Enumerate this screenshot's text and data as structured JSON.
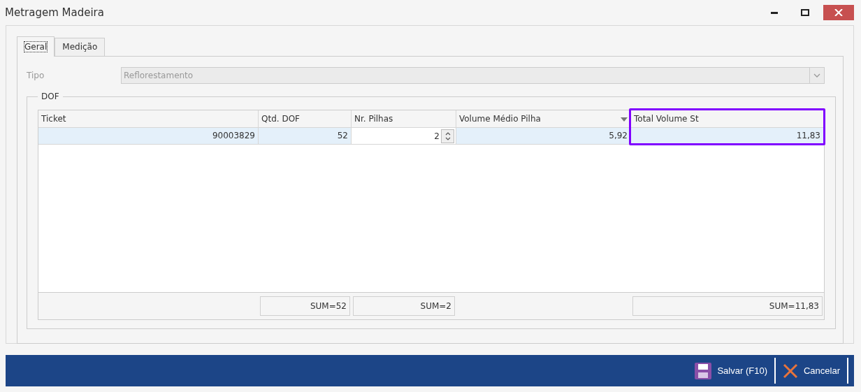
{
  "window": {
    "title": "Metragem Madeira"
  },
  "tabs": [
    {
      "label": "Geral",
      "selected": true
    },
    {
      "label": "Medição",
      "selected": false
    }
  ],
  "tipo": {
    "label": "Tipo",
    "value": "Reflorestamento",
    "disabled": true
  },
  "group": {
    "title": "DOF"
  },
  "grid": {
    "columns": [
      {
        "label": "Ticket",
        "sorted": false,
        "highlighted": false
      },
      {
        "label": "Qtd. DOF",
        "sorted": false,
        "highlighted": false
      },
      {
        "label": "Nr. Pilhas",
        "sorted": false,
        "highlighted": false
      },
      {
        "label": "Volume Médio Pilha",
        "sorted": true,
        "highlighted": false
      },
      {
        "label": "Total Volume St",
        "sorted": false,
        "highlighted": true
      }
    ],
    "rows": [
      {
        "selected": true,
        "cells": [
          {
            "kind": "text",
            "value": "90003829"
          },
          {
            "kind": "text",
            "value": "52"
          },
          {
            "kind": "spin",
            "value": "2"
          },
          {
            "kind": "text",
            "value": "5,92"
          },
          {
            "kind": "text",
            "value": "11,83"
          }
        ]
      }
    ],
    "footer": [
      {
        "kind": "blank"
      },
      {
        "kind": "sum",
        "value": "SUM=52"
      },
      {
        "kind": "sum",
        "value": "SUM=2"
      },
      {
        "kind": "blank"
      },
      {
        "kind": "sum",
        "value": "SUM=11,83"
      }
    ]
  },
  "buttons": [
    {
      "kind": "save",
      "label": "Salvar (F10)"
    },
    {
      "kind": "cancel",
      "label": "Cancelar"
    }
  ]
}
